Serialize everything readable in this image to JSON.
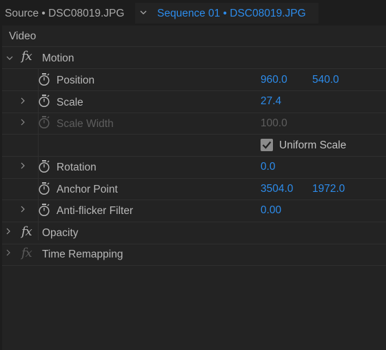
{
  "tabs": {
    "source_label": "Source • DSC08019.JPG",
    "sequence_label": "Sequence 01 • DSC08019.JPG"
  },
  "section": {
    "title": "Video"
  },
  "effects": {
    "motion": {
      "label": "Motion",
      "fx_symbol": "fx",
      "properties": {
        "position": {
          "label": "Position",
          "x": "960.0",
          "y": "540.0"
        },
        "scale": {
          "label": "Scale",
          "value": "27.4"
        },
        "scale_width": {
          "label": "Scale Width",
          "value": "100.0"
        },
        "uniform_scale": {
          "label": "Uniform Scale",
          "checked": true
        },
        "rotation": {
          "label": "Rotation",
          "value": "0.0"
        },
        "anchor_point": {
          "label": "Anchor Point",
          "x": "3504.0",
          "y": "1972.0"
        },
        "anti_flicker": {
          "label": "Anti-flicker Filter",
          "value": "0.00"
        }
      }
    },
    "opacity": {
      "label": "Opacity",
      "fx_symbol": "fx"
    },
    "time_remapping": {
      "label": "Time Remapping",
      "fx_symbol": "fx"
    }
  },
  "colors": {
    "value_blue": "#2d8ceb",
    "panel_bg": "#232323",
    "text": "#b5b5b5",
    "disabled": "#5e5e5e"
  },
  "icons": [
    "chevron-down-icon",
    "chevron-right-icon",
    "stopwatch-icon",
    "checkbox-checked-icon"
  ]
}
